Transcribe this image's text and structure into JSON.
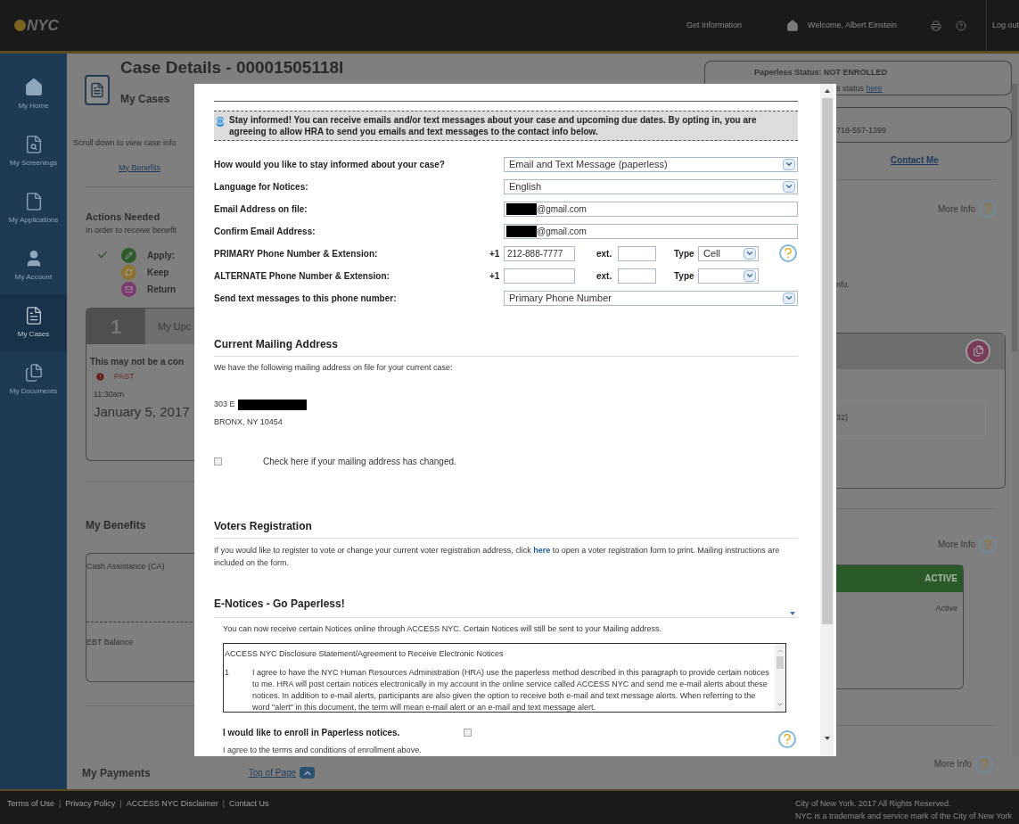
{
  "header": {
    "logo": "NYC",
    "get_information": "Get Information",
    "welcome": "Welcome, Albert Einstein",
    "logout": "Log out"
  },
  "sidebar": {
    "items": [
      {
        "kind": "home",
        "label": "My Home",
        "selected": false
      },
      {
        "kind": "screenings",
        "label": "My Screenings",
        "selected": false
      },
      {
        "kind": "applications",
        "label": "My Applications",
        "selected": false
      },
      {
        "kind": "account",
        "label": "My Account",
        "selected": false
      },
      {
        "kind": "cases",
        "label": "My Cases",
        "selected": true
      },
      {
        "kind": "documents",
        "label": "My Documents",
        "selected": false
      }
    ]
  },
  "page": {
    "title": "Case Details - 00001505118I",
    "subtitle": "My Cases",
    "paperless_status": "Paperless Status: NOT ENROLLED",
    "left": {
      "page_hint": "Scroll down to view case info",
      "benefits_link": "My Benefits",
      "actions_title": "Actions Needed",
      "actions_hint": "In order to receive benefit",
      "actions": [
        {
          "kind": "apply",
          "done": true,
          "text": "Apply:"
        },
        {
          "kind": "keep",
          "done": false,
          "text": "Keep"
        },
        {
          "kind": "return",
          "done": false,
          "text": "Return"
        }
      ],
      "appointment": {
        "number": "1",
        "title": "My Upc",
        "notice": "This may not be a con",
        "status": "PAST",
        "time": "11:30am",
        "date": "January 5, 2017"
      },
      "benefits_title": "My Benefits",
      "benefit_card": {
        "program": "Cash Assistance (CA)",
        "balance_label": "EBT Balance"
      }
    },
    "right": {
      "status_prefix": "s status",
      "status_link": "here",
      "phone": "718-557-1399",
      "contact_link": "Contact Me",
      "more_info_actions": "More Info",
      "actions_tail": "nfo.",
      "appointment_tail": "32)",
      "more_info_benefits": "More Info",
      "benefit_status": "ACTIVE",
      "benefit_state": "Active"
    },
    "bottom": {
      "payments_title": "My Payments",
      "top_link": "Top of Page",
      "more_info": "More Info"
    }
  },
  "modal": {
    "banner": "Stay informed! You can receive emails and/or text messages about your case and upcoming due dates. By opting in, you are agreeing to allow HRA to send you emails and text messages to the contact info below.",
    "rows": [
      {
        "kind": "select",
        "label": "How would you like to stay informed about your case?",
        "value": "Email and Text Message (paperless)"
      },
      {
        "kind": "select",
        "label": "Language for Notices:",
        "value": "English"
      },
      {
        "kind": "email",
        "label": "Email Address on file:",
        "value": "@gmail.com"
      },
      {
        "kind": "email",
        "label": "Confirm Email Address:",
        "value": "@gmail.com"
      },
      {
        "kind": "phone",
        "label": "PRIMARY Phone Number & Extension:",
        "prefix": "+1",
        "value": "212-888-7777",
        "ext_label": "ext.",
        "type_label": "Type",
        "type_value": "Cell",
        "help": true
      },
      {
        "kind": "phone",
        "label": "ALTERNATE Phone Number & Extension:",
        "prefix": "+1",
        "ext_label": "ext.",
        "type_label": "Type",
        "help": false
      },
      {
        "kind": "select",
        "label": "Send text messages to this phone number:",
        "value": "Primary Phone Number"
      }
    ],
    "address": {
      "title": "Current Mailing Address",
      "intro": "We have the following mailing address on file for your current case:",
      "street": "303 E",
      "city": "BRONX, NY 10454",
      "change_label": "Check here if your mailing address has changed.",
      "changed": false
    },
    "voters": {
      "title": "Voters Registration",
      "text_before": "If you would like to register to vote or change your current voter registration address, click ",
      "link": "here",
      "text_after": " to open a voter registration form to print. Mailing instructions are included on the form."
    },
    "enotices": {
      "title": "E-Notices - Go Paperless!",
      "intro": "You can now receive certain Notices online through ACCESS NYC. Certain Notices will still be sent to your Mailing address.",
      "agreement_title": "ACCESS NYC Disclosure Statement/Agreement to Receive Electronic Notices",
      "clause_number": "1",
      "clause": "I agree to have the NYC Human Resources Administration (HRA) use the paperless method described in this paragraph to provide certain notices to me. HRA will post certain notices electronically in my account in the online service called ACCESS NYC and send me e-mail alerts about these notices. In addition to e-mail alerts, participants are also given the option to receive both e-mail and text message alerts. When referring to the word \"alert\" in this document, the term will mean e-mail alert or an e-mail and text message alert.",
      "enroll_label": "I would like to enroll in Paperless notices.",
      "enrolled": false,
      "terms": "I agree to the terms and conditions of enrollment above."
    }
  },
  "footer": {
    "items": [
      {
        "kind": "link",
        "text": "Terms of Use"
      },
      {
        "kind": "separator",
        "text": "|"
      },
      {
        "kind": "link",
        "text": "Privacy Policy"
      },
      {
        "kind": "separator",
        "text": "|"
      },
      {
        "kind": "link",
        "text": "ACCESS NYC Disclaimer"
      },
      {
        "kind": "separator",
        "text": "|"
      },
      {
        "kind": "link",
        "text": "Contact Us"
      }
    ],
    "copyright": "City of New York. 2017 All Rights Reserved.",
    "trademark": "NYC is a trademark and service mark of the City of New York"
  }
}
